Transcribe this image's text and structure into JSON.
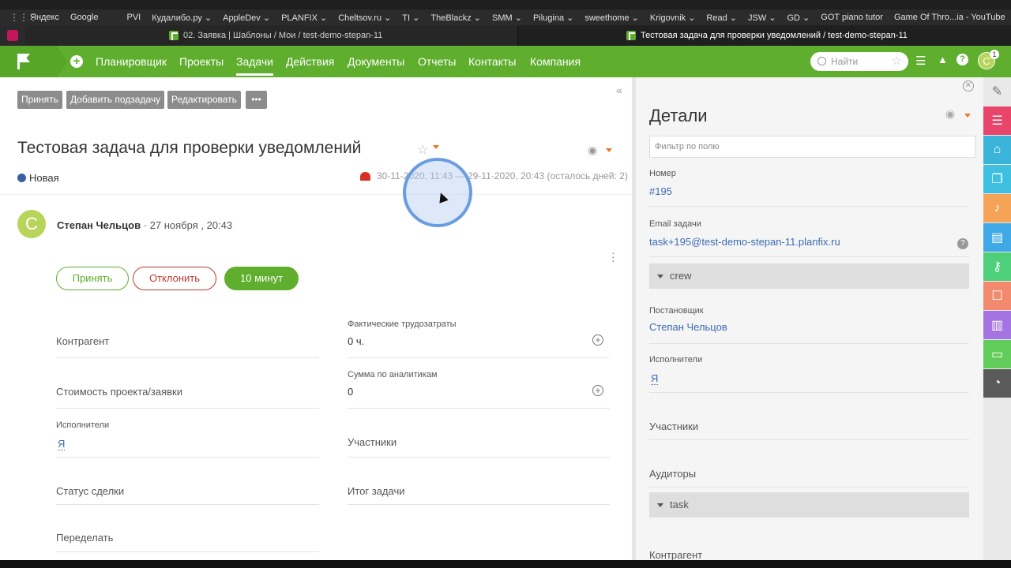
{
  "browser": {
    "bookmarks": [
      "Яндекс",
      "Google",
      "PVI",
      "Кудалибо.ру ⌄",
      "AppleDev ⌄",
      "PLANFIX ⌄",
      "Cheltsov.ru ⌄",
      "TI ⌄",
      "TheBlackz ⌄",
      "SMM ⌄",
      "Pilugina ⌄",
      "sweethome ⌄",
      "Krigovnik ⌄",
      "Read ⌄",
      "JSW ⌄",
      "GD ⌄",
      "GOT piano tutor",
      "Game Of Thro...ia - YouTube"
    ],
    "tabs": [
      "02. Заявка | Шаблоны / Мои / test-demo-stepan-11",
      "Тестовая задача для проверки уведомлений / test-demo-stepan-11"
    ]
  },
  "topnav": {
    "items": [
      "Планировщик",
      "Проекты",
      "Задачи",
      "Действия",
      "Документы",
      "Отчеты",
      "Контакты",
      "Компания"
    ],
    "active": "Задачи",
    "search_placeholder": "Найти",
    "avatar_letter": "С",
    "avatar_badge": "1"
  },
  "toolbar": {
    "accept": "Принять",
    "add_subtask": "Добавить подзадачу",
    "edit": "Редактировать",
    "more": "•••"
  },
  "task": {
    "title": "Тестовая задача для проверки уведомлений",
    "status": "Новая",
    "deadline": "30-11-2020, 11:43 — 29-11-2020, 20:43 (осталось дней: 2)",
    "author_initial": "С",
    "author": "Степан Чельцов",
    "date": "· 27 ноября , 20:43",
    "actions": {
      "accept": "Принять",
      "reject": "Отклонить",
      "timer": "10 минут"
    },
    "fields": {
      "contractor": "Контрагент",
      "actual_costs_label": "Фактические трудозатраты",
      "actual_costs_value": "0 ч.",
      "project_cost": "Стоимость проекта/заявки",
      "analytics_sum_label": "Сумма по аналитикам",
      "analytics_sum_value": "0",
      "executors_label": "Исполнители",
      "executors_value": "Я",
      "participants": "Участники",
      "deal_status": "Статус сделки",
      "task_result": "Итог задачи",
      "redo": "Переделать"
    }
  },
  "details": {
    "title": "Детали",
    "filter_placeholder": "Фильтр по полю",
    "number_label": "Номер",
    "number_value": "#195",
    "email_label": "Email задачи",
    "email_value": "task+195@test-demo-stepan-11.planfix.ru",
    "group_crew": "crew",
    "setter_label": "Постановщик",
    "setter_value": "Степан Чельцов",
    "executors_label": "Исполнители",
    "executors_value": "Я",
    "participants": "Участники",
    "auditors": "Аудиторы",
    "group_task": "task",
    "contractor": "Контрагент"
  },
  "colors": {
    "brand_green": "#5fae2d",
    "link_blue": "#3b6bb3",
    "status_new": "#3b5fa5",
    "reject_red": "#c0392b",
    "accent_orange": "#e57b1f"
  },
  "rightbar_icons": [
    "list-icon",
    "hierarchy-icon",
    "documents-icon",
    "bell-icon",
    "clipboard-icon",
    "key-icon",
    "contact-card-icon",
    "notebook-icon",
    "chat-icon",
    "clock-icon"
  ]
}
